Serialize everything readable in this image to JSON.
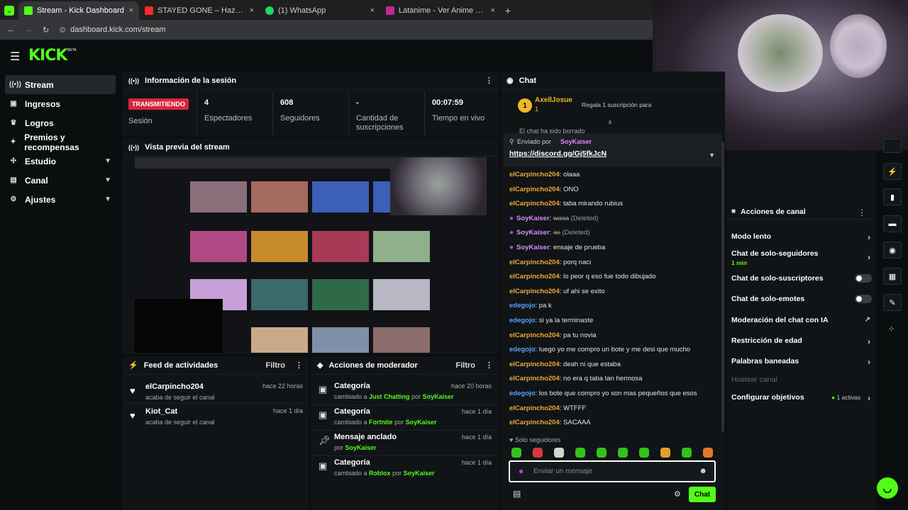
{
  "browser": {
    "tabs": [
      {
        "title": "Stream - Kick Dashboard",
        "color": "#53fc18"
      },
      {
        "title": "STAYED GONE – Hazbin Hotel",
        "color": "#ff2a2a"
      },
      {
        "title": "(1) WhatsApp",
        "color": "#25d366"
      },
      {
        "title": "Latanime - Ver Anime Online F",
        "color": "#c3288f"
      }
    ],
    "close_glyph": "×",
    "new_tab_glyph": "+",
    "url": "dashboard.kick.com/stream"
  },
  "brand": {
    "logo": "KICK",
    "badge": "BETA"
  },
  "sidebar": {
    "items": [
      {
        "label": "Stream",
        "icon": "broadcast-icon"
      },
      {
        "label": "Ingresos",
        "icon": "wallet-icon"
      },
      {
        "label": "Logros",
        "icon": "trophy-icon"
      },
      {
        "label": "Premios y recompensas",
        "icon": "gift-icon"
      },
      {
        "label": "Estudio",
        "icon": "studio-icon"
      },
      {
        "label": "Canal",
        "icon": "channel-icon"
      },
      {
        "label": "Ajustes",
        "icon": "gear-icon"
      }
    ]
  },
  "session": {
    "title": "Información de la sesión",
    "badge": "TRANSMITIENDO",
    "badge_label": "Sesión",
    "stats": [
      {
        "value": "4",
        "label": "Espectadores"
      },
      {
        "value": "608",
        "label": "Seguidores"
      },
      {
        "value": "-",
        "label": "Cantidad de suscripciones"
      },
      {
        "value": "00:07:59",
        "label": "Tiempo en vivo"
      }
    ]
  },
  "preview": {
    "title": "Vista previa del stream"
  },
  "feed": {
    "title": "Feed de actividades",
    "filter": "Filtro",
    "items": [
      {
        "name": "elCarpincho204",
        "action": "acaba de seguir el canal",
        "time": "hace 22 horas"
      },
      {
        "name": "Kiot_Cat",
        "action": "acaba de seguir el canal",
        "time": "hace 1 día"
      }
    ]
  },
  "modactions": {
    "title": "Acciones de moderador",
    "filter": "Filtro",
    "items": [
      {
        "title": "Categoría",
        "pre": "cambiado a",
        "target": "Just Chatting",
        "mid": "por",
        "by": "SoyKaiser",
        "time": "hace 20 horas"
      },
      {
        "title": "Categoría",
        "pre": "cambiado a",
        "target": "Fortnite",
        "mid": "por",
        "by": "SoyKaiser",
        "time": "hace 1 día"
      },
      {
        "title": "Mensaje anclado",
        "pre": "por",
        "target": "SoyKaiser",
        "mid": "",
        "by": "",
        "time": "hace 1 día"
      },
      {
        "title": "Categoría",
        "pre": "cambiado a",
        "target": "Roblox",
        "mid": "por",
        "by": "SoyKaiser",
        "time": "hace 1 día"
      }
    ]
  },
  "chat": {
    "title": "Chat",
    "gifter": {
      "name": "AxellJosue",
      "rank": "1",
      "count": "1",
      "text": "Regala 1 suscripción para"
    },
    "cleared": "El chat ha sido borrado",
    "pinned": {
      "label": "Enviado por",
      "by": "SoyKaiser",
      "link": "https://discord.gg/Gj5fkJcN"
    },
    "messages": [
      {
        "user": "elCarpincho204",
        "color": "orange",
        "text": "olaaa"
      },
      {
        "user": "elCarpincho204",
        "color": "orange",
        "text": "ONO"
      },
      {
        "user": "elCarpincho204",
        "color": "orange",
        "text": "taba mirando rubius"
      },
      {
        "user": "SoyKaiser",
        "color": "purple",
        "deleted": "wasa",
        "note": "(Deleted)"
      },
      {
        "user": "SoyKaiser",
        "color": "purple",
        "deleted": "as",
        "note": "(Deleted)"
      },
      {
        "user": "SoyKaiser",
        "color": "purple",
        "text": "ensaje de prueba"
      },
      {
        "user": "elCarpincho204",
        "color": "orange",
        "text": "porq naci"
      },
      {
        "user": "elCarpincho204",
        "color": "orange",
        "text": "lo peor q eso fue todo dibujado"
      },
      {
        "user": "elCarpincho204",
        "color": "orange",
        "text": "uf ahi se exito"
      },
      {
        "user": "edegojo",
        "color": "blue",
        "text": "pa k"
      },
      {
        "user": "edegojo",
        "color": "blue",
        "text": "si ya la terminaste"
      },
      {
        "user": "elCarpincho204",
        "color": "orange",
        "text": "pa tu novia"
      },
      {
        "user": "edegojo",
        "color": "blue",
        "text": "luego yo me compro un bote y me desi que mucho"
      },
      {
        "user": "elCarpincho204",
        "color": "orange",
        "text": "deah ni que estaba"
      },
      {
        "user": "elCarpincho204",
        "color": "orange",
        "text": "no era q taba tan hermosa"
      },
      {
        "user": "edegojo",
        "color": "blue",
        "text": "los bote que compro yo son mas pequeños que esos"
      },
      {
        "user": "elCarpincho204",
        "color": "orange",
        "text": "WTFFF"
      },
      {
        "user": "elCarpincho204",
        "color": "orange",
        "text": "SACAAA"
      }
    ],
    "followers_only": "Solo seguidores",
    "placeholder": "Enviar un mensaje",
    "send": "Chat"
  },
  "channel_actions": {
    "title": "Acciones de canal",
    "items": [
      {
        "label": "Modo lento",
        "control": "chevron"
      },
      {
        "label": "Chat de solo-seguidores",
        "sub": "1 min",
        "control": "chevron"
      },
      {
        "label": "Chat de solo-suscriptores",
        "control": "toggle"
      },
      {
        "label": "Chat de solo-emotes",
        "control": "toggle"
      },
      {
        "label": "Moderación del chat con IA",
        "control": "external"
      },
      {
        "label": "Restricción de edad",
        "control": "chevron"
      },
      {
        "label": "Palabras baneadas",
        "control": "chevron"
      },
      {
        "label": "Hostear canal",
        "control": "none",
        "disabled": true
      },
      {
        "label": "Configurar objetivos",
        "badge": "1 activas",
        "control": "chevron"
      }
    ]
  },
  "colors": {
    "accent": "#53fc18",
    "live": "#d7263d"
  }
}
